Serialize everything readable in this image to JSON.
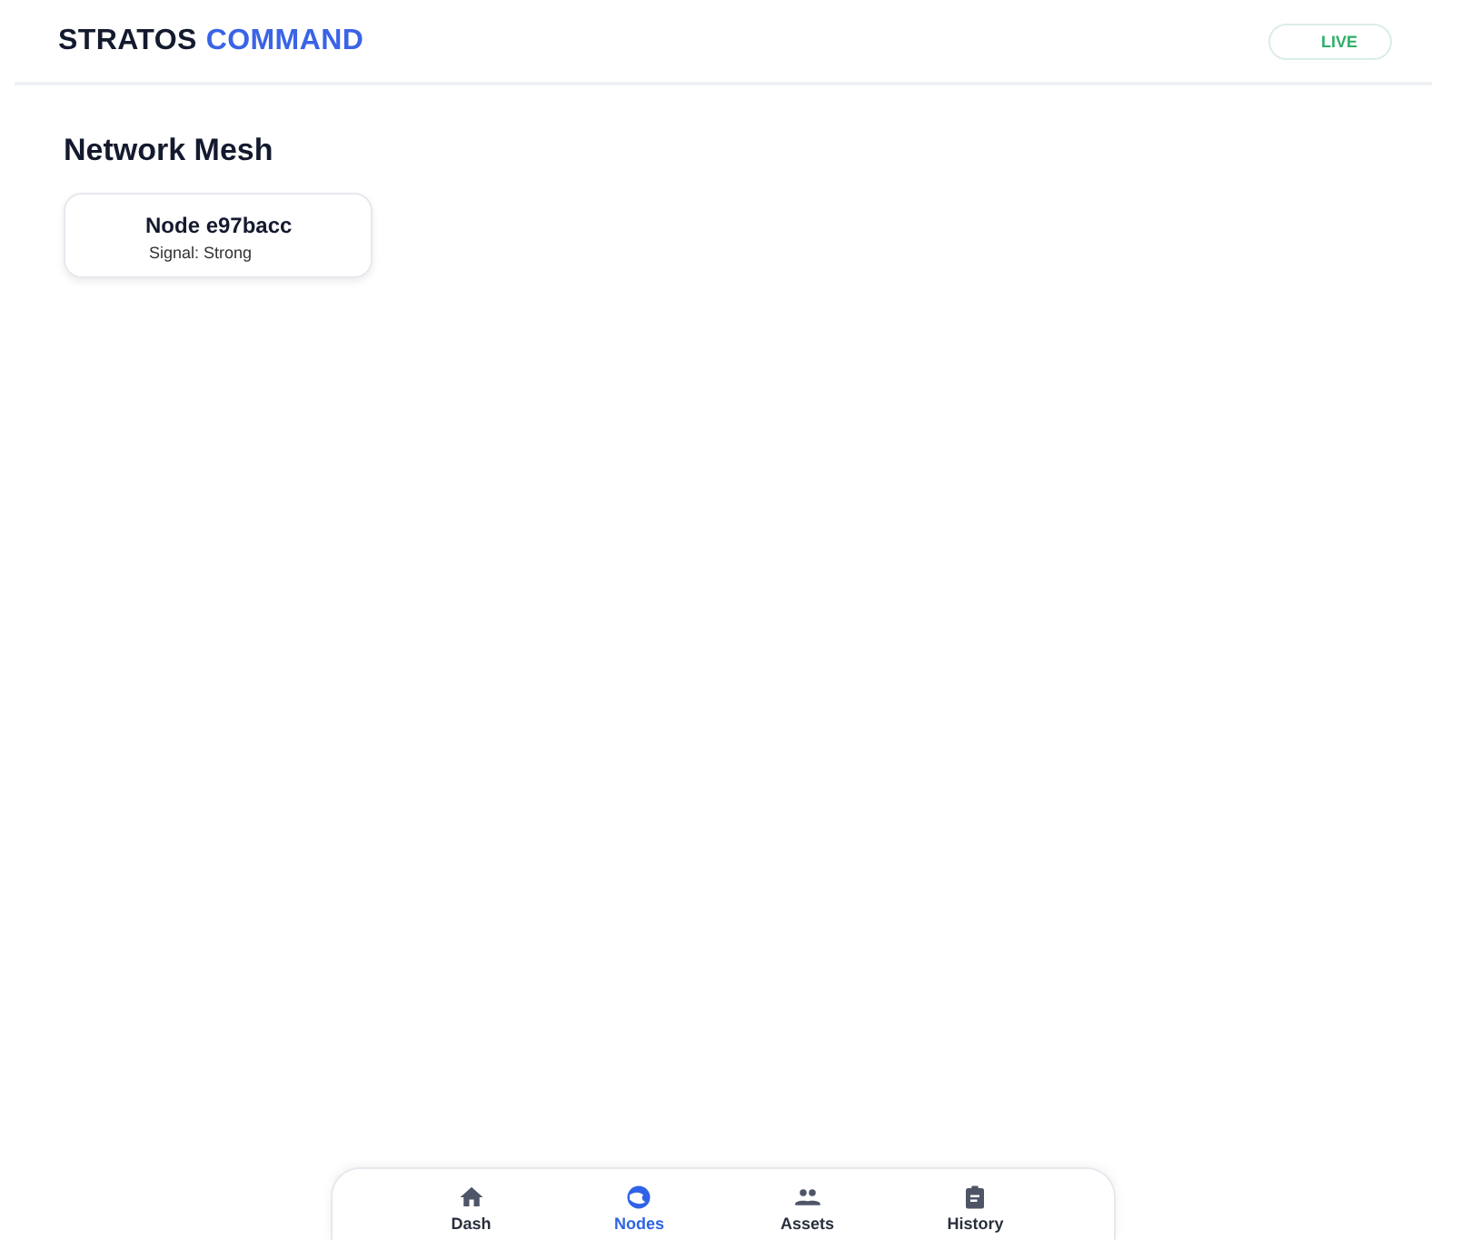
{
  "header": {
    "brand": "STRATOS",
    "brand_accent": "COMMAND",
    "status": "LIVE"
  },
  "section": {
    "title": "Network Mesh"
  },
  "nodes": [
    {
      "name": "Node e97bacc",
      "signal": "Signal: Strong"
    }
  ],
  "nav": [
    {
      "label": "Dash",
      "kind": "home",
      "selected": false
    },
    {
      "label": "Nodes",
      "kind": "globe",
      "selected": true
    },
    {
      "label": "Assets",
      "kind": "people",
      "selected": false
    },
    {
      "label": "History",
      "kind": "clipboard",
      "selected": false
    }
  ]
}
